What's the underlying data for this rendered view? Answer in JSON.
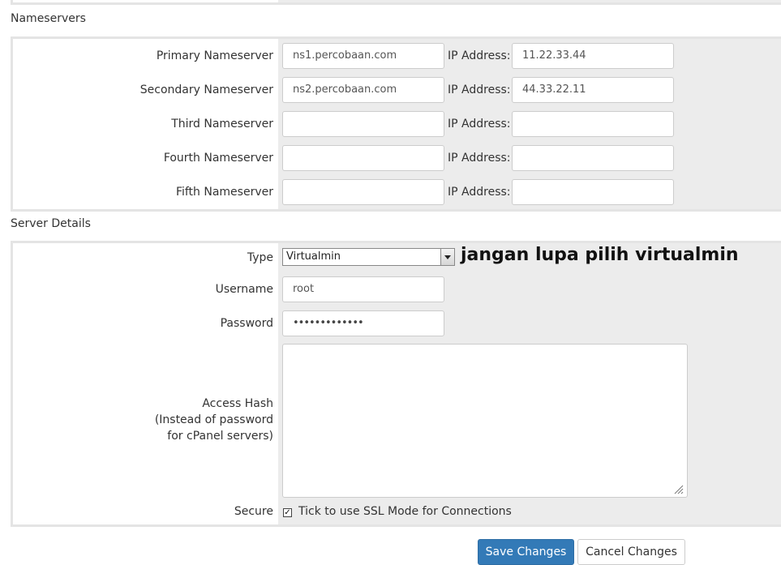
{
  "nameservers": {
    "section_title": "Nameservers",
    "ip_label": "IP Address:",
    "rows": [
      {
        "label": "Primary Nameserver",
        "hostname": "ns1.percobaan.com",
        "ip": "11.22.33.44"
      },
      {
        "label": "Secondary Nameserver",
        "hostname": "ns2.percobaan.com",
        "ip": "44.33.22.11"
      },
      {
        "label": "Third Nameserver",
        "hostname": "",
        "ip": ""
      },
      {
        "label": "Fourth Nameserver",
        "hostname": "",
        "ip": ""
      },
      {
        "label": "Fifth Nameserver",
        "hostname": "",
        "ip": ""
      }
    ]
  },
  "server_details": {
    "section_title": "Server Details",
    "type": {
      "label": "Type",
      "selected": "Virtualmin",
      "note": "jangan lupa pilih virtualmin"
    },
    "username": {
      "label": "Username",
      "value": "root"
    },
    "password": {
      "label": "Password",
      "value": "•••••••••••••"
    },
    "access_hash": {
      "label_lines": [
        "Access Hash",
        "(Instead of password",
        "for cPanel servers)"
      ],
      "value": ""
    },
    "secure": {
      "label": "Secure",
      "checked": true,
      "checkbox_label": "Tick to use SSL Mode for Connections"
    }
  },
  "buttons": {
    "save": "Save Changes",
    "cancel": "Cancel Changes"
  },
  "colors": {
    "primary_button": "#337ab7",
    "field_background": "#ececec",
    "border": "#e4e4e4"
  }
}
